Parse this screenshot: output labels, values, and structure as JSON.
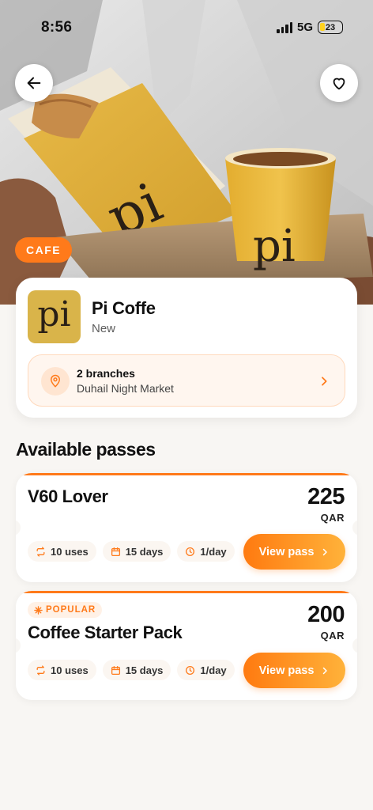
{
  "status_bar": {
    "time": "8:56",
    "network": "5G",
    "battery": "23"
  },
  "hero": {
    "category": "CAFE",
    "logo_text": "pi"
  },
  "venue": {
    "name": "Pi Coffe",
    "status": "New",
    "logo_text": "pi",
    "branches_count": "2 branches",
    "branches_location": "Duhail Night Market"
  },
  "passes_section": {
    "title": "Available passes"
  },
  "passes": [
    {
      "name": "V60 Lover",
      "price": "225",
      "currency": "QAR",
      "badge": "",
      "uses": "10 uses",
      "duration": "15 days",
      "frequency": "1/day",
      "cta": "View pass"
    },
    {
      "name": "Coffee Starter Pack",
      "price": "200",
      "currency": "QAR",
      "badge": "POPULAR",
      "uses": "10 uses",
      "duration": "15 days",
      "frequency": "1/day",
      "cta": "View pass"
    }
  ],
  "colors": {
    "accent": "#ff7a1a",
    "accent_light": "#ffb23a",
    "background": "#f8f6f3",
    "logo_gold": "#d9b44a"
  },
  "icons": {
    "back": "arrow-left-icon",
    "favorite": "heart-icon",
    "location": "map-pin-icon",
    "uses": "repeat-icon",
    "duration": "calendar-icon",
    "frequency": "clock-icon",
    "cta": "chevron-right-icon",
    "popular": "sparkle-icon"
  }
}
